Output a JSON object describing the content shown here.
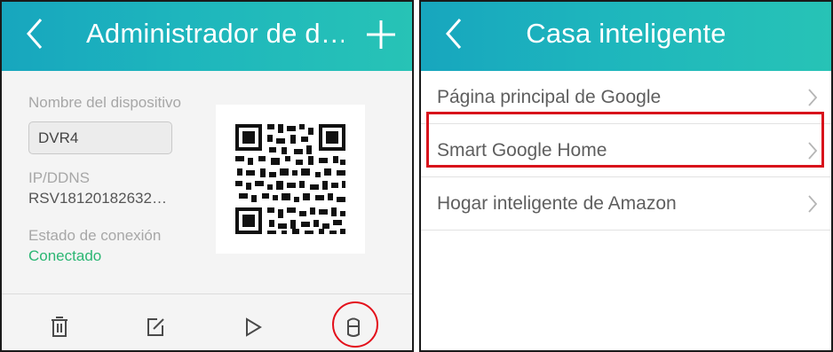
{
  "left_screen": {
    "title": "Administrador de d…",
    "icons": {
      "back": "back-chevron-icon",
      "add": "plus-icon"
    },
    "device_name_label": "Nombre del dispositivo",
    "device_name_value": "DVR4",
    "ip_label": "IP/DDNS",
    "ip_value": "RSV18120182632…",
    "connection_label": "Estado de conexión",
    "connection_value": "Conectado",
    "qr_code": "qr-code-icon",
    "actions": [
      "trash-icon",
      "edit-icon",
      "play-icon",
      "smart-home-icon"
    ],
    "colors": {
      "header": "#1eb6bd",
      "status_green": "#2bb673",
      "highlight_red": "#e3101b"
    }
  },
  "right_screen": {
    "title": "Casa inteligente",
    "icons": {
      "back": "back-chevron-icon"
    },
    "items": [
      {
        "label": "Página principal de Google"
      },
      {
        "label": "Smart Google Home",
        "highlighted": true
      },
      {
        "label": "Hogar inteligente de Amazon"
      }
    ]
  }
}
